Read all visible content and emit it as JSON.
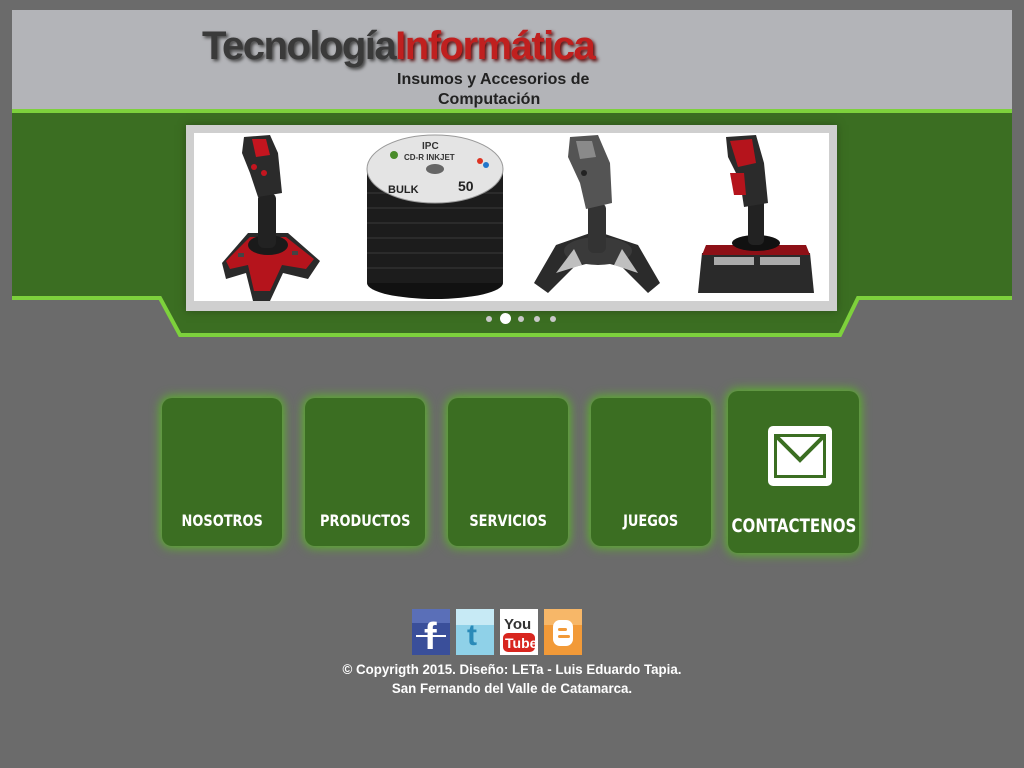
{
  "header": {
    "logo_part1": "Tecnología",
    "logo_part2": "Informática",
    "subtitle_line1": "Insumos y Accesorios de",
    "subtitle_line2": "Computación"
  },
  "slider": {
    "slide_count": 5,
    "active_index": 1,
    "items": [
      "joystick-red-icon",
      "cd-spindle-icon",
      "joystick-gray-icon",
      "joystick-pro-icon"
    ],
    "cd_label_brand": "IPC",
    "cd_label_type": "CD-R INKJET",
    "cd_label_bulk": "BULK",
    "cd_label_qty": "50"
  },
  "nav": {
    "tiles": [
      {
        "label": "NOSOTROS"
      },
      {
        "label": "PRODUCTOS"
      },
      {
        "label": "SERVICIOS"
      },
      {
        "label": "JUEGOS"
      },
      {
        "label": "CONTACTENOS"
      }
    ]
  },
  "social": {
    "facebook": "f",
    "twitter": "t",
    "youtube_top": "You",
    "youtube_bottom": "Tube",
    "blogger": "B"
  },
  "footer": {
    "line1": "© Copyrigth 2015. Diseño: LETa - Luis Eduardo Tapia.",
    "line2": "San Fernando del Valle de Catamarca."
  },
  "colors": {
    "background": "#6b6b6b",
    "header_bg": "#b3b4b8",
    "banner_green": "#3b6e22",
    "accent_green": "#7dd13c",
    "logo_red": "#c0201f"
  }
}
